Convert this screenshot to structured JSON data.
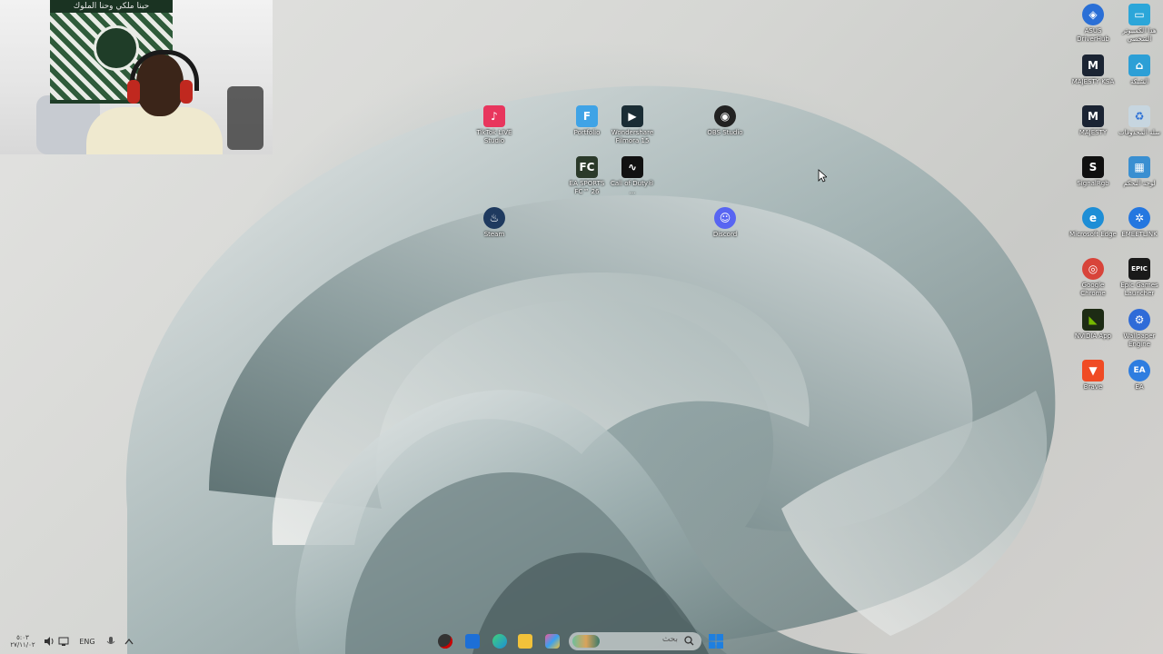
{
  "webcam": {
    "banner_text": "حبنا ملكي وحنا الملوك"
  },
  "desktop_icons": [
    {
      "id": "tiktok",
      "label": "TikTok LIVE Studio",
      "color": "#e8365d",
      "glyph": "♪",
      "icon": "tiktok-icon"
    },
    {
      "id": "portfolio",
      "label": "Portfolio",
      "color": "#3fa3e6",
      "glyph": "F",
      "icon": "portfolio-icon"
    },
    {
      "id": "filmora",
      "label": "Wondershare Filmora 15",
      "color": "#1b2d35",
      "glyph": "▶",
      "icon": "filmora-icon"
    },
    {
      "id": "obs",
      "label": "OBS Studio",
      "color": "#222222",
      "glyph": "◉",
      "icon": "obs-icon"
    },
    {
      "id": "fc26",
      "label": "EA SPORTS FC™ 26",
      "color": "#2b3a2a",
      "glyph": "FC",
      "icon": "fc26-icon"
    },
    {
      "id": "cod",
      "label": "Call of Duty® ...",
      "color": "#111111",
      "glyph": "∿",
      "icon": "cod-icon"
    },
    {
      "id": "steam",
      "label": "Steam",
      "color": "#1f3a5f",
      "glyph": "♨",
      "icon": "steam-icon"
    },
    {
      "id": "discord",
      "label": "Discord",
      "color": "#5865f2",
      "glyph": "☺",
      "icon": "discord-icon"
    },
    {
      "id": "asus",
      "label": "ASUS DriverHub",
      "color": "#2a6fd6",
      "glyph": "◈",
      "icon": "asus-icon"
    },
    {
      "id": "thispc",
      "label": "هذا الكمبيوتر الشخصي",
      "color": "#2ba6d9",
      "glyph": "▭",
      "icon": "this-pc-icon"
    },
    {
      "id": "majesty1",
      "label": "MAJESTY KSA",
      "color": "#1b2433",
      "glyph": "M",
      "icon": "majesty-icon"
    },
    {
      "id": "network",
      "label": "الشبكة",
      "color": "#2c9fd6",
      "glyph": "⌂",
      "icon": "network-icon"
    },
    {
      "id": "majesty2",
      "label": "MAJESTY",
      "color": "#1b2433",
      "glyph": "M",
      "icon": "majesty-icon"
    },
    {
      "id": "recycle",
      "label": "سلة المحذوفات",
      "color": "#c7d6e0",
      "glyph": "♻",
      "icon": "recycle-bin-icon"
    },
    {
      "id": "signalrgb",
      "label": "SignalRgb",
      "color": "#101010",
      "glyph": "S",
      "icon": "signalrgb-icon"
    },
    {
      "id": "controlpanel",
      "label": "لوحة التحكم",
      "color": "#3a8fd1",
      "glyph": "▦",
      "icon": "control-panel-icon"
    },
    {
      "id": "edge",
      "label": "Microsoft Edge",
      "color": "#1e8ed6",
      "glyph": "e",
      "icon": "edge-icon"
    },
    {
      "id": "emeet",
      "label": "EMEETLINK",
      "color": "#2477e0",
      "glyph": "✲",
      "icon": "emeetlink-icon"
    },
    {
      "id": "chrome",
      "label": "Google Chrome",
      "color": "#d8443a",
      "glyph": "◎",
      "icon": "chrome-icon"
    },
    {
      "id": "epic",
      "label": "Epic Games Launcher",
      "color": "#1a1a1a",
      "glyph": "EPIC",
      "icon": "epic-games-icon"
    },
    {
      "id": "nvidia",
      "label": "NVIDIA App",
      "color": "#1d2b14",
      "glyph": "◣",
      "icon": "nvidia-icon"
    },
    {
      "id": "wallpaper",
      "label": "Wallpaper Engine",
      "color": "#2f6bd8",
      "glyph": "⚙",
      "icon": "wallpaper-engine-icon"
    },
    {
      "id": "brave",
      "label": "Brave",
      "color": "#f04b24",
      "glyph": "▼",
      "icon": "brave-icon"
    },
    {
      "id": "ea",
      "label": "EA",
      "color": "#2e7de0",
      "glyph": "EA",
      "icon": "ea-icon"
    }
  ],
  "taskbar": {
    "search_placeholder": "بحث",
    "language": "ENG",
    "time": "٥:٠٣",
    "date": "٢٧/١١/٠٢"
  }
}
